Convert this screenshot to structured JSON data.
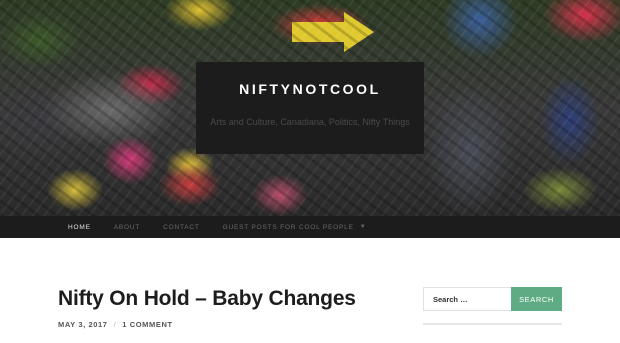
{
  "header": {
    "site_title": "NIFTYNOTCOOL",
    "tagline": "Arts and Culture, Canadiana, Politics, Nifty Things"
  },
  "nav": {
    "items": [
      {
        "label": "HOME"
      },
      {
        "label": "ABOUT"
      },
      {
        "label": "CONTACT"
      },
      {
        "label": "GUEST POSTS FOR COOL PEOPLE"
      }
    ]
  },
  "post": {
    "title": "Nifty On Hold – Baby Changes",
    "date": "MAY 3, 2017",
    "separator": "/",
    "comments": "1 COMMENT"
  },
  "sidebar": {
    "search_placeholder": "Search …",
    "search_button": "SEARCH"
  },
  "colors": {
    "accent": "#5fab84",
    "dark_bar": "#1c1c1c"
  }
}
